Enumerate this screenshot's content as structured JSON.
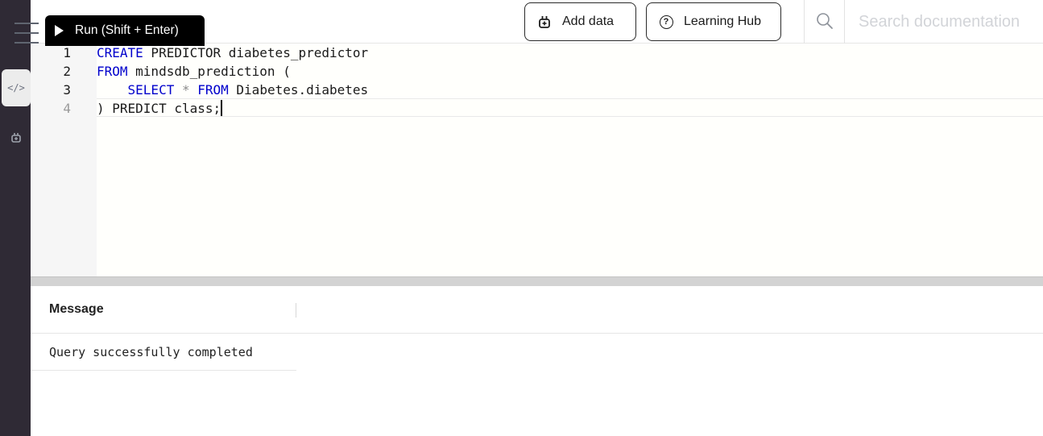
{
  "toolbar": {
    "run_label": "Run (Shift + Enter)",
    "add_data_label": "Add data",
    "learning_hub_label": "Learning Hub",
    "search_placeholder": "Search documentation"
  },
  "editor": {
    "line_numbers": [
      "1",
      "2",
      "3",
      "4"
    ],
    "lines": [
      [
        {
          "t": "CREATE",
          "k": "kw"
        },
        {
          "t": " PREDICTOR diabetes_predictor",
          "k": ""
        }
      ],
      [
        {
          "t": "FROM",
          "k": "kw"
        },
        {
          "t": " mindsdb_prediction (",
          "k": ""
        }
      ],
      [
        {
          "t": "    ",
          "k": ""
        },
        {
          "t": "SELECT",
          "k": "kw"
        },
        {
          "t": " ",
          "k": ""
        },
        {
          "t": "*",
          "k": "op"
        },
        {
          "t": " ",
          "k": ""
        },
        {
          "t": "FROM",
          "k": "kw"
        },
        {
          "t": " Diabetes.diabetes",
          "k": ""
        }
      ],
      [
        {
          "t": ") PREDICT class;",
          "k": ""
        }
      ]
    ]
  },
  "results": {
    "column_header": "Message",
    "rows": [
      "Query successfully completed"
    ]
  },
  "colors": {
    "rail": "#2f2a35",
    "keyword": "#0000cc",
    "run_button": "#000000"
  }
}
